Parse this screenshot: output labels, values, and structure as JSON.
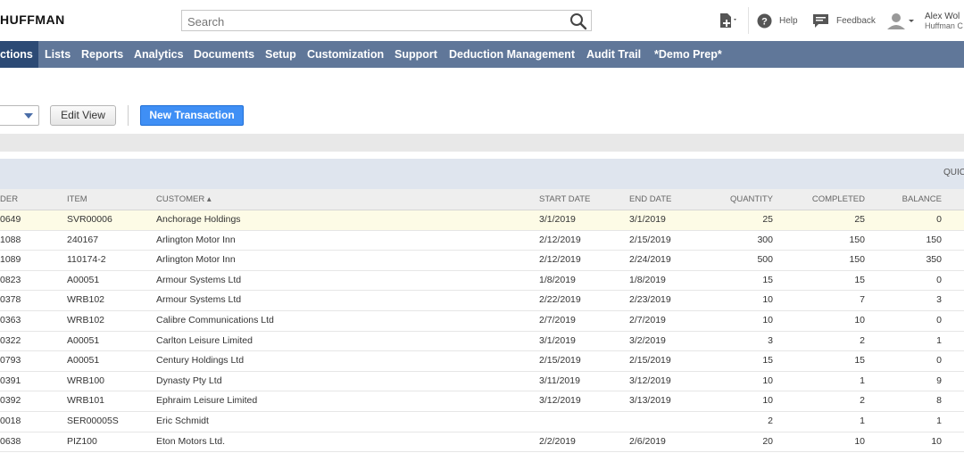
{
  "header": {
    "logo": "HUFFMAN",
    "search_placeholder": "Search",
    "help_label": "Help",
    "feedback_label": "Feedback",
    "user_name": "Alex Wol",
    "user_org": "Huffman C"
  },
  "nav": {
    "items": [
      "ctions",
      "Lists",
      "Reports",
      "Analytics",
      "Documents",
      "Setup",
      "Customization",
      "Support",
      "Deduction Management",
      "Audit Trail",
      "*Demo Prep*"
    ]
  },
  "toolbar": {
    "edit_view_label": "Edit View",
    "new_transaction_label": "New Transaction"
  },
  "quick_label": "QUIC",
  "table": {
    "columns": [
      "DER",
      "ITEM",
      "CUSTOMER ▴",
      "START DATE",
      "END DATE",
      "QUANTITY",
      "COMPLETED",
      "BALANCE"
    ],
    "rows": [
      {
        "order": "0649",
        "item": "SVR00006",
        "customer": "Anchorage Holdings",
        "start": "3/1/2019",
        "end": "3/1/2019",
        "qty": "25",
        "completed": "25",
        "balance": "0"
      },
      {
        "order": "1088",
        "item": "240167",
        "customer": "Arlington Motor Inn",
        "start": "2/12/2019",
        "end": "2/15/2019",
        "qty": "300",
        "completed": "150",
        "balance": "150"
      },
      {
        "order": "1089",
        "item": "110174-2",
        "customer": "Arlington Motor Inn",
        "start": "2/12/2019",
        "end": "2/24/2019",
        "qty": "500",
        "completed": "150",
        "balance": "350"
      },
      {
        "order": "0823",
        "item": "A00051",
        "customer": "Armour Systems Ltd",
        "start": "1/8/2019",
        "end": "1/8/2019",
        "qty": "15",
        "completed": "15",
        "balance": "0"
      },
      {
        "order": "0378",
        "item": "WRB102",
        "customer": "Armour Systems Ltd",
        "start": "2/22/2019",
        "end": "2/23/2019",
        "qty": "10",
        "completed": "7",
        "balance": "3"
      },
      {
        "order": "0363",
        "item": "WRB102",
        "customer": "Calibre Communications Ltd",
        "start": "2/7/2019",
        "end": "2/7/2019",
        "qty": "10",
        "completed": "10",
        "balance": "0"
      },
      {
        "order": "0322",
        "item": "A00051",
        "customer": "Carlton Leisure Limited",
        "start": "3/1/2019",
        "end": "3/2/2019",
        "qty": "3",
        "completed": "2",
        "balance": "1"
      },
      {
        "order": "0793",
        "item": "A00051",
        "customer": "Century Holdings Ltd",
        "start": "2/15/2019",
        "end": "2/15/2019",
        "qty": "15",
        "completed": "15",
        "balance": "0"
      },
      {
        "order": "0391",
        "item": "WRB100",
        "customer": "Dynasty Pty Ltd",
        "start": "3/11/2019",
        "end": "3/12/2019",
        "qty": "10",
        "completed": "1",
        "balance": "9"
      },
      {
        "order": "0392",
        "item": "WRB101",
        "customer": "Ephraim Leisure Limited",
        "start": "3/12/2019",
        "end": "3/13/2019",
        "qty": "10",
        "completed": "2",
        "balance": "8"
      },
      {
        "order": "0018",
        "item": "SER00005S",
        "customer": "Eric Schmidt",
        "start": "",
        "end": "",
        "qty": "2",
        "completed": "1",
        "balance": "1"
      },
      {
        "order": "0638",
        "item": "PIZ100",
        "customer": "Eton Motors Ltd.",
        "start": "2/2/2019",
        "end": "2/6/2019",
        "qty": "20",
        "completed": "10",
        "balance": "10"
      }
    ]
  },
  "colors": {
    "nav_bg": "#607799",
    "nav_active": "#2c4a75",
    "primary_button": "#3f8ff5",
    "row_highlight": "#fdfbe6"
  }
}
